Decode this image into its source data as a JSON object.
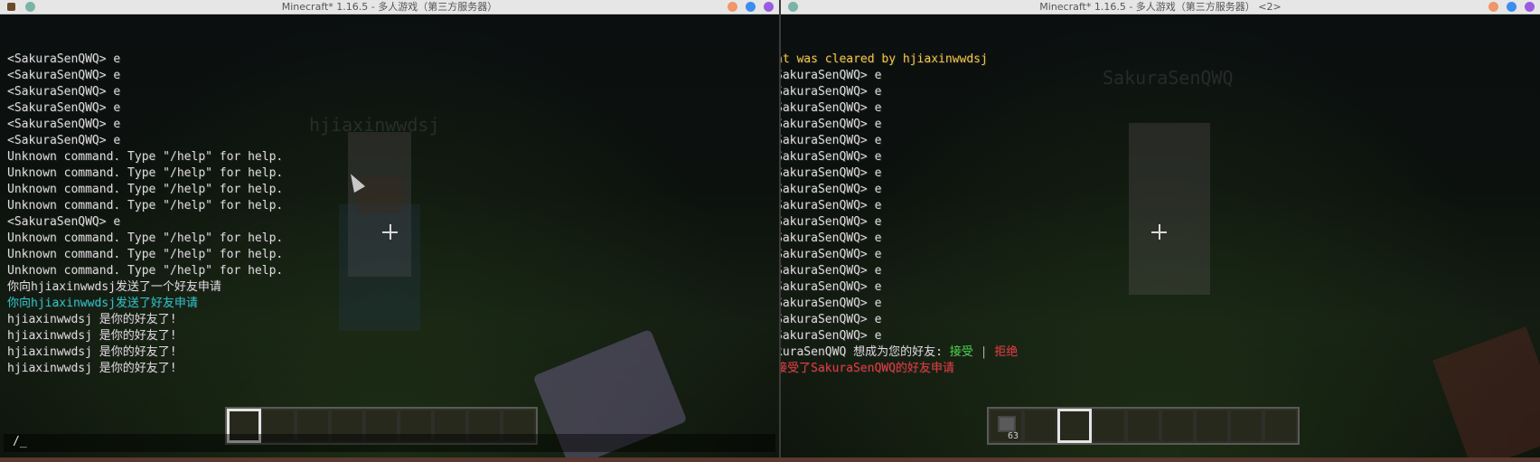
{
  "window1": {
    "title": "Minecraft* 1.16.5 - 多人游戏（第三方服务器）",
    "nametag": "hjiaxinwwdsj",
    "chat": [
      {
        "text": "<SakuraSenQWQ> e",
        "color": "white"
      },
      {
        "text": "<SakuraSenQWQ> e",
        "color": "white"
      },
      {
        "text": "<SakuraSenQWQ> e",
        "color": "white"
      },
      {
        "text": "<SakuraSenQWQ> e",
        "color": "white"
      },
      {
        "text": "<SakuraSenQWQ> e",
        "color": "white"
      },
      {
        "text": "<SakuraSenQWQ> e",
        "color": "white"
      },
      {
        "text": "Unknown command. Type \"/help\" for help.",
        "color": "white"
      },
      {
        "text": "Unknown command. Type \"/help\" for help.",
        "color": "white"
      },
      {
        "text": "Unknown command. Type \"/help\" for help.",
        "color": "white"
      },
      {
        "text": "Unknown command. Type \"/help\" for help.",
        "color": "white"
      },
      {
        "text": "<SakuraSenQWQ> e",
        "color": "white"
      },
      {
        "text": "Unknown command. Type \"/help\" for help.",
        "color": "white"
      },
      {
        "text": "Unknown command. Type \"/help\" for help.",
        "color": "white"
      },
      {
        "text": "Unknown command. Type \"/help\" for help.",
        "color": "white"
      },
      {
        "text": "你向hjiaxinwwdsj发送了一个好友申请",
        "color": "white"
      },
      {
        "text": "你向hjiaxinwwdsj发送了好友申请",
        "color": "cyan"
      },
      {
        "text": "hjiaxinwwdsj 是你的好友了!",
        "color": "white"
      },
      {
        "text": "hjiaxinwwdsj 是你的好友了!",
        "color": "white"
      },
      {
        "text": "hjiaxinwwdsj 是你的好友了!",
        "color": "white"
      },
      {
        "text": "hjiaxinwwdsj 是你的好友了!",
        "color": "white"
      }
    ],
    "command_input": "/_",
    "hotbar_slots": 9,
    "hotbar_selected": 0
  },
  "window2": {
    "title": "Minecraft* 1.16.5 - 多人游戏（第三方服务器） <2>",
    "nametag": "SakuraSenQWQ",
    "chat": [
      {
        "text": "at was cleared by ",
        "color": "yellow",
        "extra": "hjiaxinwwdsj"
      },
      {
        "text": "SakuraSenQWQ> e",
        "color": "white"
      },
      {
        "text": "SakuraSenQWQ> e",
        "color": "white"
      },
      {
        "text": "SakuraSenQWQ> e",
        "color": "white"
      },
      {
        "text": "SakuraSenQWQ> e",
        "color": "white"
      },
      {
        "text": "SakuraSenQWQ> e",
        "color": "white"
      },
      {
        "text": "SakuraSenQWQ> e",
        "color": "white"
      },
      {
        "text": "SakuraSenQWQ> e",
        "color": "white"
      },
      {
        "text": "SakuraSenQWQ> e",
        "color": "white"
      },
      {
        "text": "SakuraSenQWQ> e",
        "color": "white"
      },
      {
        "text": "SakuraSenQWQ> e",
        "color": "white"
      },
      {
        "text": "SakuraSenQWQ> e",
        "color": "white"
      },
      {
        "text": "SakuraSenQWQ> e",
        "color": "white"
      },
      {
        "text": "SakuraSenQWQ> e",
        "color": "white"
      },
      {
        "text": "SakuraSenQWQ> e",
        "color": "white"
      },
      {
        "text": "SakuraSenQWQ> e",
        "color": "white"
      },
      {
        "text": "SakuraSenQWQ> e",
        "color": "white"
      },
      {
        "text": "SakuraSenQWQ> e",
        "color": "white"
      }
    ],
    "friend_request": {
      "prefix": "kuraSenQWQ 想成为您的好友: ",
      "accept": "接受",
      "separator": " | ",
      "reject": "拒绝"
    },
    "accepted_line": "接受了SakuraSenQWQ的好友申请",
    "hotbar_slots": 9,
    "hotbar_selected": 2,
    "slot1_count": "63"
  },
  "colors": {
    "cyan": "#29c4c4",
    "yellow": "#f5c542",
    "red": "#e83a3a",
    "green": "#48d448"
  }
}
